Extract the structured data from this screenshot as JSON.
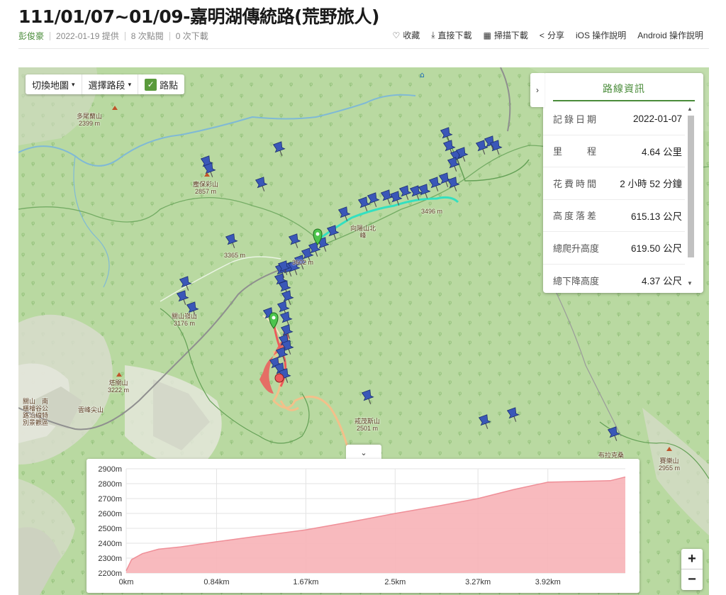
{
  "page": {
    "title": "111/01/07~01/09-嘉明湖傳統路(荒野旅人)",
    "author": "彭俊豪",
    "date_provided": "2022-01-19 提供",
    "views": "8 次點閱",
    "downloads": "0 次下載"
  },
  "actions": [
    {
      "label": "收藏",
      "icon": "heart-icon",
      "glyph": "♡"
    },
    {
      "label": "直接下載",
      "icon": "download-icon",
      "glyph": "⤓"
    },
    {
      "label": "掃描下載",
      "icon": "qrcode-icon",
      "glyph": "▦"
    },
    {
      "label": "分享",
      "icon": "share-icon",
      "glyph": "<"
    },
    {
      "label": "iOS 操作說明",
      "icon": "",
      "glyph": ""
    },
    {
      "label": "Android 操作說明",
      "icon": "",
      "glyph": ""
    }
  ],
  "map_controls": {
    "switch_map": "切換地圖",
    "select_segment": "選擇路段",
    "waypoints": "路點",
    "waypoints_checked": true
  },
  "route_info": {
    "title": "路線資訊",
    "rows": [
      {
        "key": "記錄日期",
        "value": "2022-01-07"
      },
      {
        "key": "里　　程",
        "value": "4.64 公里"
      },
      {
        "key": "花費時間",
        "value": "2 小時 52 分鐘"
      },
      {
        "key": "高度落差",
        "value": "615.13 公尺"
      },
      {
        "key": "總爬升高度",
        "value": "619.50 公尺"
      },
      {
        "key": "總下降高度",
        "value": "4.37 公尺"
      }
    ]
  },
  "map_labels": [
    {
      "text": "多尾蘭山\n2399 m"
    },
    {
      "text": "塵保彩山\n2857 m"
    },
    {
      "text": "3365 m"
    },
    {
      "text": "3602 m"
    },
    {
      "text": "向陽山北\n峰"
    },
    {
      "text": "3496 m"
    },
    {
      "text": "塔關山\n3222 m"
    },
    {
      "text": "關山嶺山\n3176 m"
    },
    {
      "text": "雲峰尖山"
    },
    {
      "text": "關山　南\n橫檜谷公\n路沿線特\n別景觀區"
    },
    {
      "text": "戒茂斯山\n2501 m"
    },
    {
      "text": "布拉克桑"
    },
    {
      "text": "賽樂山\n2955 m"
    }
  ],
  "zoom": {
    "in": "+",
    "out": "−"
  },
  "chart_data": {
    "type": "area",
    "title": "",
    "xlabel": "",
    "ylabel": "",
    "x_ticks": [
      "0km",
      "0.84km",
      "1.67km",
      "2.5km",
      "3.27km",
      "3.92km"
    ],
    "y_ticks": [
      "2900m",
      "2800m",
      "2700m",
      "2600m",
      "2500m",
      "2400m",
      "2300m",
      "2200m"
    ],
    "ylim": [
      2200,
      2900
    ],
    "xlim": [
      0,
      4.64
    ],
    "x": [
      0,
      0.05,
      0.15,
      0.3,
      0.5,
      0.84,
      1.2,
      1.67,
      2.1,
      2.5,
      2.9,
      3.27,
      3.6,
      3.92,
      4.2,
      4.5,
      4.64
    ],
    "y": [
      2215,
      2290,
      2330,
      2360,
      2375,
      2410,
      2445,
      2490,
      2545,
      2600,
      2650,
      2700,
      2760,
      2810,
      2815,
      2820,
      2845
    ],
    "series": [
      {
        "values": [
          2215,
          2290,
          2330,
          2360,
          2375,
          2410,
          2445,
          2490,
          2545,
          2600,
          2650,
          2700,
          2760,
          2810,
          2815,
          2820,
          2845
        ]
      }
    ],
    "fill_color": "#f7b2b7",
    "line_color": "#ef8f98",
    "grid": true
  },
  "colors": {
    "accent": "#4a8c3a",
    "map_green": "#b9d9a1",
    "pin_blue": "#3a57b8",
    "route_red": "#ec5b5b",
    "track_cyan": "#33e0c0"
  }
}
